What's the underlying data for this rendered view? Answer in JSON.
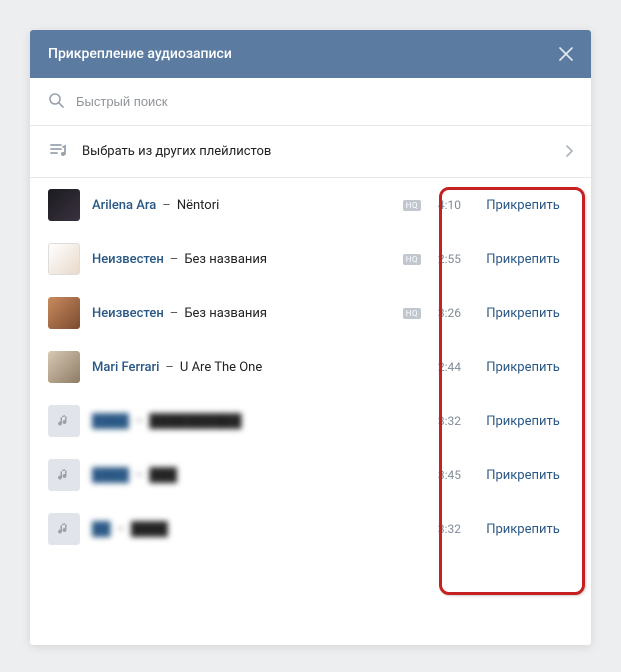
{
  "header": {
    "title": "Прикрепление аудиозаписи"
  },
  "search": {
    "placeholder": "Быстрый поиск"
  },
  "playlist_row": {
    "label": "Выбрать из других плейлистов"
  },
  "hq_label": "HQ",
  "attach_label": "Прикрепить",
  "tracks": [
    {
      "artist": "Arilena Ara",
      "title": "Nëntori",
      "duration": "4:10",
      "hq": true,
      "cover": "img-a",
      "blurred": false
    },
    {
      "artist": "Неизвестен",
      "title": "Без названия",
      "duration": "2:55",
      "hq": true,
      "cover": "img-b",
      "blurred": false
    },
    {
      "artist": "Неизвестен",
      "title": "Без названия",
      "duration": "3:26",
      "hq": true,
      "cover": "img-c",
      "blurred": false
    },
    {
      "artist": "Mari Ferrari",
      "title": "U Are The One",
      "duration": "2:44",
      "hq": false,
      "cover": "img-d",
      "blurred": false
    },
    {
      "artist": "████",
      "title": "██████████",
      "duration": "3:32",
      "hq": false,
      "cover": "note",
      "blurred": true
    },
    {
      "artist": "████",
      "title": "███",
      "duration": "3:45",
      "hq": false,
      "cover": "note",
      "blurred": true
    },
    {
      "artist": "██",
      "title": "████",
      "duration": "3:32",
      "hq": false,
      "cover": "note",
      "blurred": true
    }
  ]
}
